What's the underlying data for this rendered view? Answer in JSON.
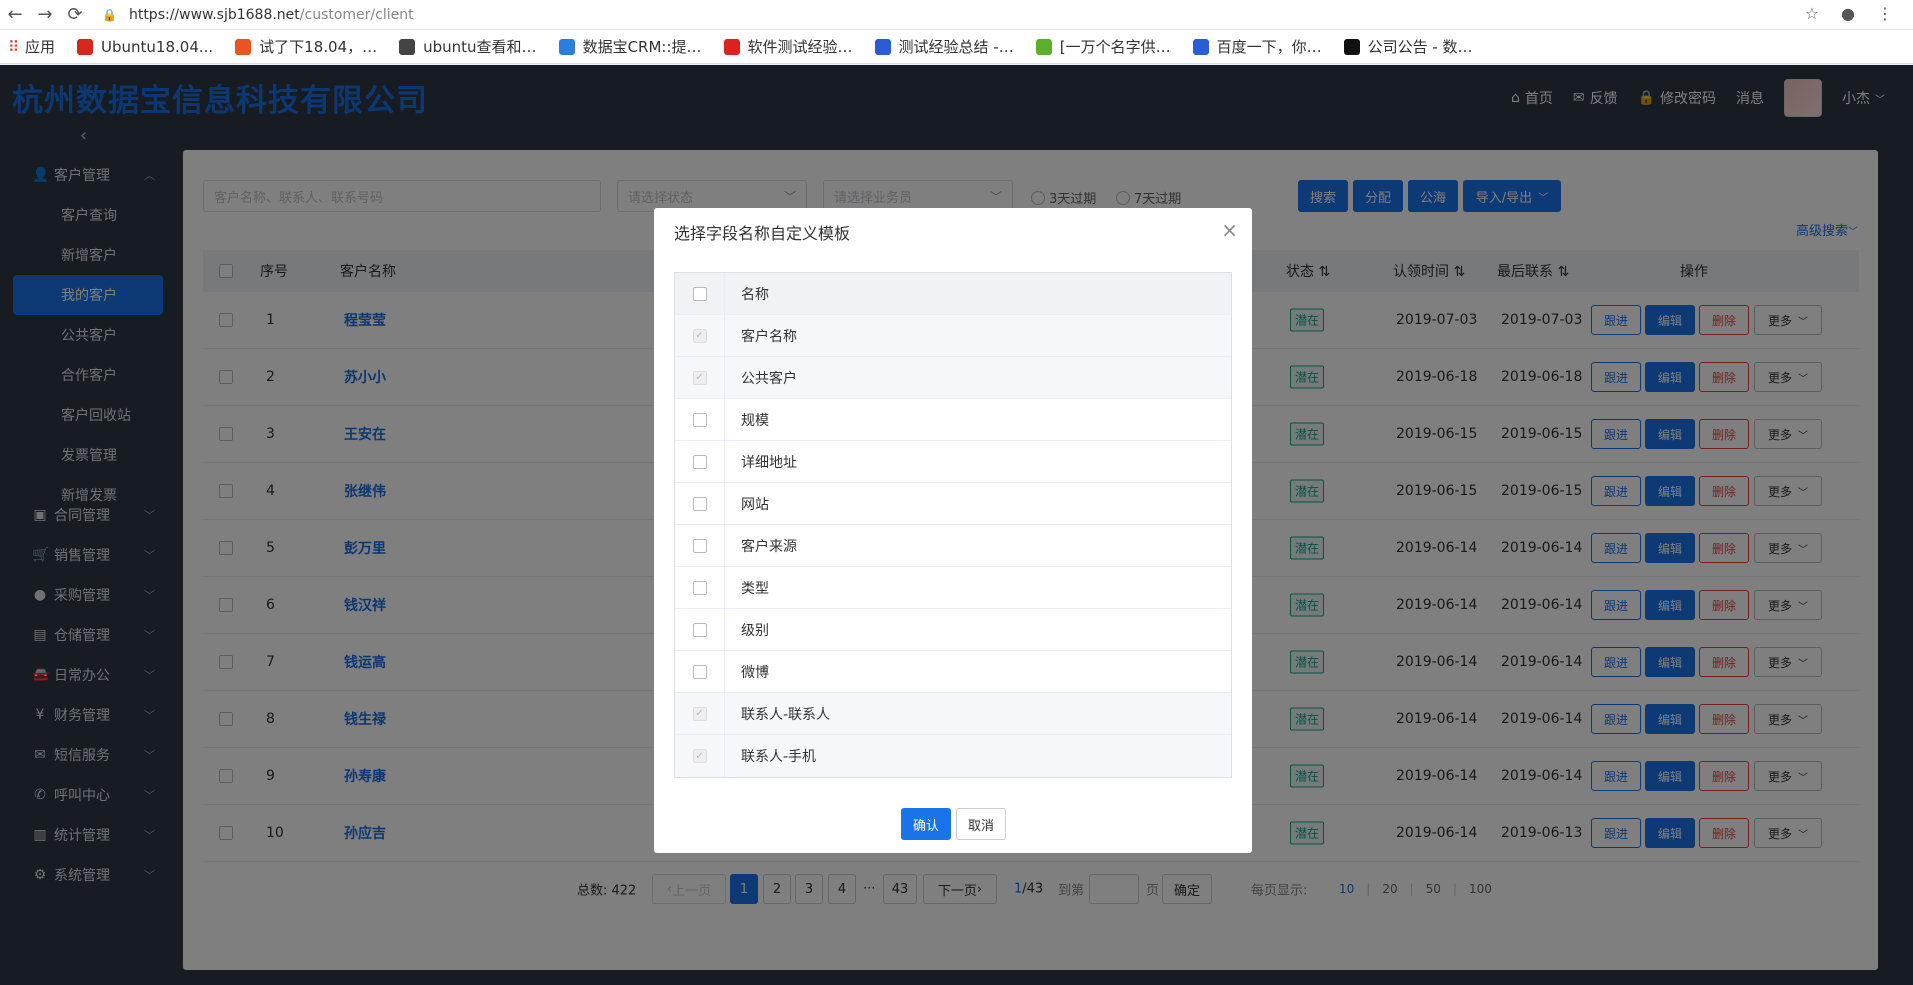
{
  "browser": {
    "url_host": "https://www.sjb1688.net",
    "url_path": "/customer/client",
    "bookmarks": [
      {
        "label": "应用",
        "color": "#e04a3a"
      },
      {
        "label": "Ubuntu18.04...",
        "color": "#d7261e"
      },
      {
        "label": "试了下18.04，…",
        "color": "#e95420"
      },
      {
        "label": "ubuntu查看和…",
        "color": "#444444"
      },
      {
        "label": "数据宝CRM::提…",
        "color": "#2a7de1"
      },
      {
        "label": "软件测试经验…",
        "color": "#e02020"
      },
      {
        "label": "测试经验总结 -…",
        "color": "#2a5cd6"
      },
      {
        "label": "[一万个名字供…",
        "color": "#5ab02a"
      },
      {
        "label": "百度一下，你…",
        "color": "#2a5cd6"
      },
      {
        "label": "公司公告 - 数…",
        "color": "#111111"
      }
    ]
  },
  "header": {
    "company": "杭州数据宝信息科技有限公司",
    "nav": [
      "首页",
      "反馈",
      "修改密码",
      "消息"
    ],
    "username": "小杰"
  },
  "sidebar": {
    "groups": [
      {
        "label": "客户管理",
        "icon": "user-icon"
      },
      {
        "label": "合同管理",
        "icon": "gift-icon"
      },
      {
        "label": "销售管理",
        "icon": "cart-icon"
      },
      {
        "label": "采购管理",
        "icon": "disc-icon"
      },
      {
        "label": "仓储管理",
        "icon": "store-icon"
      },
      {
        "label": "日常办公",
        "icon": "car-icon"
      },
      {
        "label": "财务管理",
        "icon": "yen-icon"
      },
      {
        "label": "短信服务",
        "icon": "mail-icon"
      },
      {
        "label": "呼叫中心",
        "icon": "phone-icon"
      },
      {
        "label": "统计管理",
        "icon": "chart-icon"
      },
      {
        "label": "系统管理",
        "icon": "gear-icon"
      }
    ],
    "sub_items": [
      "客户查询",
      "新增客户",
      "我的客户",
      "公共客户",
      "合作客户",
      "客户回收站",
      "发票管理",
      "新增发票"
    ],
    "active_sub": "我的客户"
  },
  "filters": {
    "keyword_placeholder": "客户名称、联系人、联系号码",
    "status_placeholder": "请选择状态",
    "salesman_placeholder": "请选择业务员",
    "radio1": "3天过期",
    "radio2": "7天过期",
    "btn_search": "搜索",
    "btn_assign": "分配",
    "btn_public": "公海",
    "btn_import": "导入/导出",
    "advanced": "高级搜索"
  },
  "table": {
    "headers": {
      "no": "序号",
      "name": "客户名称",
      "status": "状态",
      "claim": "认领时间",
      "last": "最后联系",
      "ops": "操作"
    },
    "ops": {
      "follow": "跟进",
      "edit": "编辑",
      "delete": "删除",
      "more": "更多"
    },
    "rows": [
      {
        "no": "1",
        "name": "程莹莹",
        "status": "潜在",
        "claim": "2019-07-03",
        "last": "2019-07-03"
      },
      {
        "no": "2",
        "name": "苏小小",
        "status": "潜在",
        "claim": "2019-06-18",
        "last": "2019-06-18"
      },
      {
        "no": "3",
        "name": "王安在",
        "status": "潜在",
        "claim": "2019-06-15",
        "last": "2019-06-15"
      },
      {
        "no": "4",
        "name": "张继伟",
        "status": "潜在",
        "claim": "2019-06-15",
        "last": "2019-06-15"
      },
      {
        "no": "5",
        "name": "彭万里",
        "status": "潜在",
        "claim": "2019-06-14",
        "last": "2019-06-14"
      },
      {
        "no": "6",
        "name": "钱汉祥",
        "status": "潜在",
        "claim": "2019-06-14",
        "last": "2019-06-14"
      },
      {
        "no": "7",
        "name": "钱运高",
        "status": "潜在",
        "claim": "2019-06-14",
        "last": "2019-06-14"
      },
      {
        "no": "8",
        "name": "钱生禄",
        "status": "潜在",
        "claim": "2019-06-14",
        "last": "2019-06-14"
      },
      {
        "no": "9",
        "name": "孙寿康",
        "status": "潜在",
        "claim": "2019-06-14",
        "last": "2019-06-14"
      },
      {
        "no": "10",
        "name": "孙应吉",
        "status": "潜在",
        "claim": "2019-06-14",
        "last": "2019-06-13"
      }
    ]
  },
  "pager": {
    "total": "总数: 422",
    "prev": "上一页",
    "pages": [
      "1",
      "2",
      "3",
      "4"
    ],
    "ellipsis": "···",
    "last_page": "43",
    "next": "下一页",
    "page_info_cur": "1",
    "page_info_total": "/43",
    "goto_label": "到第",
    "page_unit": "页",
    "confirm": "确定",
    "per_page_label": "每页显示:",
    "sizes": [
      "10",
      "20",
      "50",
      "100"
    ]
  },
  "dialog": {
    "title": "选择字段名称自定义模板",
    "header_label": "名称",
    "fields": [
      {
        "label": "客户名称",
        "disabled": true
      },
      {
        "label": "公共客户",
        "disabled": true
      },
      {
        "label": "规模",
        "disabled": false
      },
      {
        "label": "详细地址",
        "disabled": false
      },
      {
        "label": "网站",
        "disabled": false
      },
      {
        "label": "客户来源",
        "disabled": false
      },
      {
        "label": "类型",
        "disabled": false
      },
      {
        "label": "级别",
        "disabled": false
      },
      {
        "label": "微博",
        "disabled": false
      },
      {
        "label": "联系人-联系人",
        "disabled": true
      },
      {
        "label": "联系人-手机",
        "disabled": true
      }
    ],
    "ok": "确认",
    "cancel": "取消"
  },
  "colors": {
    "accent": "#1a73e8",
    "danger": "#e64444",
    "tag": "#14a390",
    "sidebar_bg": "#2f3644"
  }
}
